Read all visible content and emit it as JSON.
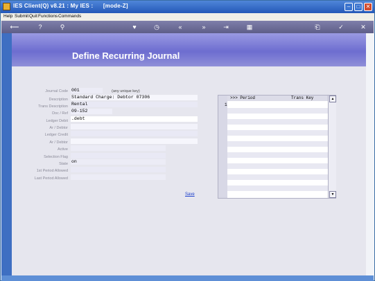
{
  "window": {
    "title": "IES Client(Q) v8.21 : My IES :      [mode-Z]"
  },
  "menu": [
    "Help",
    "Submit",
    "Quit",
    "Functions",
    "Commands"
  ],
  "toolbar": {
    "icons": [
      "back-arrow-icon",
      "info-icon",
      "search-icon",
      "heart-icon",
      "clock-icon",
      "rewind-icon",
      "fast-forward-icon",
      "end-icon",
      "grid-icon",
      "save-disk-icon",
      "check-icon",
      "close-icon"
    ],
    "glyphs": [
      "⟵",
      "?",
      "⚲",
      "♥",
      "◷",
      "«",
      "»",
      "⇥",
      "▦",
      "⎗",
      "✓",
      "✕"
    ]
  },
  "page": {
    "title": "Define Recurring Journal"
  },
  "form": {
    "journal_code": {
      "label": "Journal Code",
      "value": "001",
      "hint": "(any unique key)"
    },
    "description": {
      "label": "Description",
      "value": "Standard Charge: Debtor 07306"
    },
    "trans_description": {
      "label": "Trans Description",
      "value": "Rental"
    },
    "doc_ref": {
      "label": "Doc / Ref",
      "value": "09-152"
    },
    "ledger_debit": {
      "label": "Ledger Debit",
      "value": ".debt"
    },
    "ar_debtor_1": {
      "label": "Ar / Debtor",
      "value": ""
    },
    "ledger_credit": {
      "label": "Ledger Credit",
      "value": ""
    },
    "ar_debtor_2": {
      "label": "Ar / Debtor",
      "value": ""
    },
    "active": {
      "label": "Active",
      "value": ""
    },
    "selection_flag": {
      "label": "Selection Flag",
      "value": ""
    },
    "state": {
      "label": "State",
      "value": "on"
    },
    "first_period": {
      "label": "1st Period Allowed",
      "value": ""
    },
    "last_period": {
      "label": "Last Period Allowed",
      "value": ""
    }
  },
  "save_label": "Save",
  "period_grid": {
    "col1": ">>> Period",
    "col2": "Trans Key",
    "row1_number": "1",
    "scroll_up": "▲",
    "scroll_down": "▼"
  }
}
